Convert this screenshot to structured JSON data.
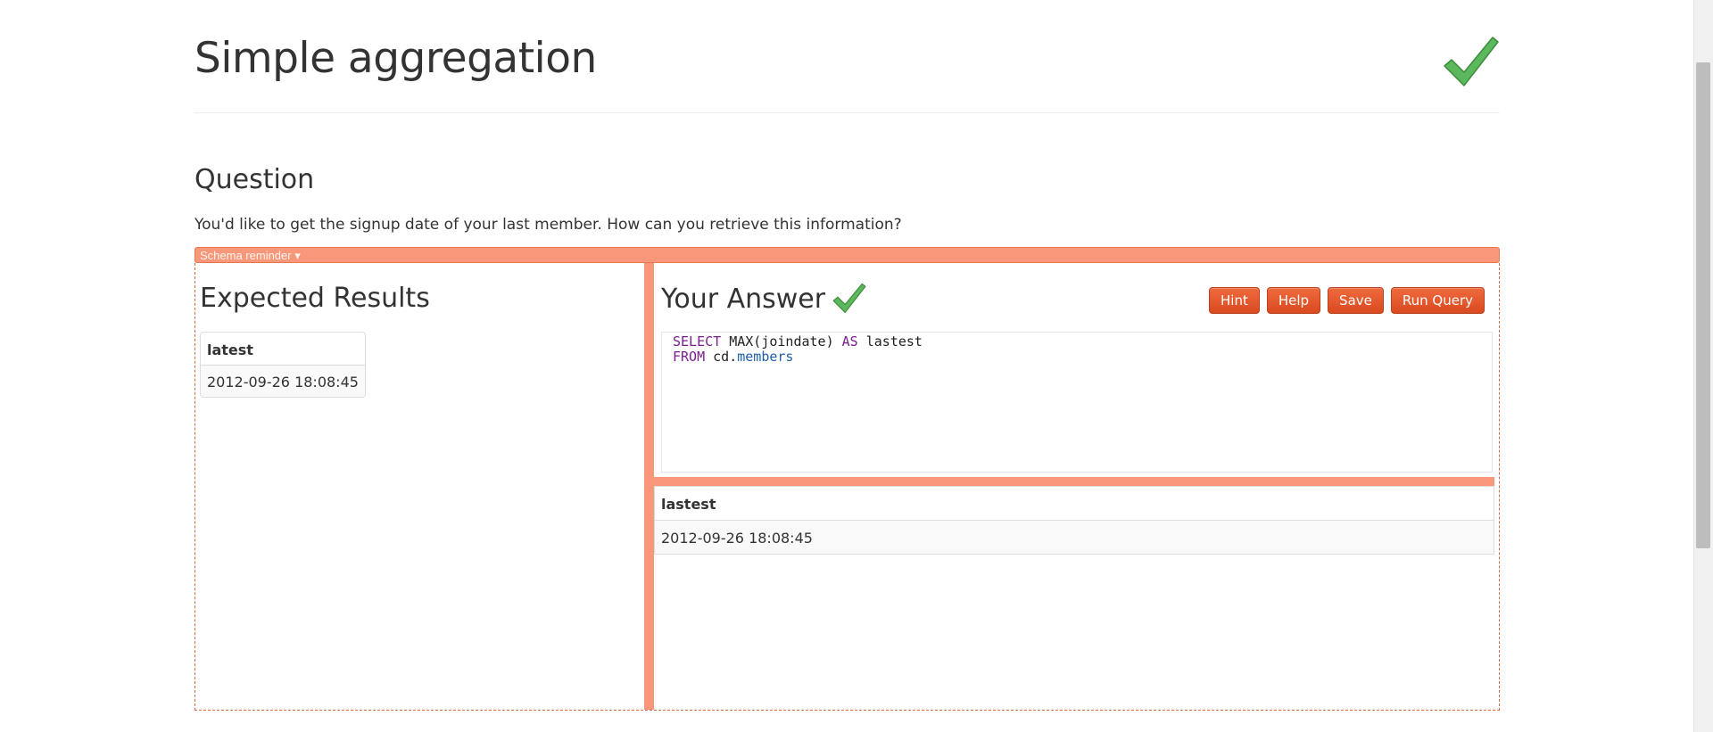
{
  "page": {
    "title": "Simple aggregation",
    "status_icon": "checkmark-icon",
    "accent_color": "#f8977a",
    "success_color": "#5cb85c"
  },
  "question": {
    "heading": "Question",
    "text": "You'd like to get the signup date of your last member. How can you retrieve this information?"
  },
  "schema": {
    "label": "Schema reminder ▾"
  },
  "expected": {
    "heading": "Expected Results",
    "columns": [
      "latest"
    ],
    "rows": [
      [
        "2012-09-26 18:08:45"
      ]
    ]
  },
  "answer": {
    "heading": "Your Answer",
    "status_icon": "checkmark-icon",
    "buttons": {
      "hint": "Hint",
      "help": "Help",
      "save": "Save",
      "run": "Run Query"
    },
    "query_line1": {
      "kw1": "SELECT",
      "text1": " MAX(joindate) ",
      "kw2": "AS",
      "text2": " lastest"
    },
    "query_line2": {
      "kw1": "FROM",
      "text1": " cd.",
      "prop": "members"
    },
    "result_columns": [
      "lastest"
    ],
    "result_rows": [
      [
        "2012-09-26 18:08:45"
      ]
    ]
  }
}
